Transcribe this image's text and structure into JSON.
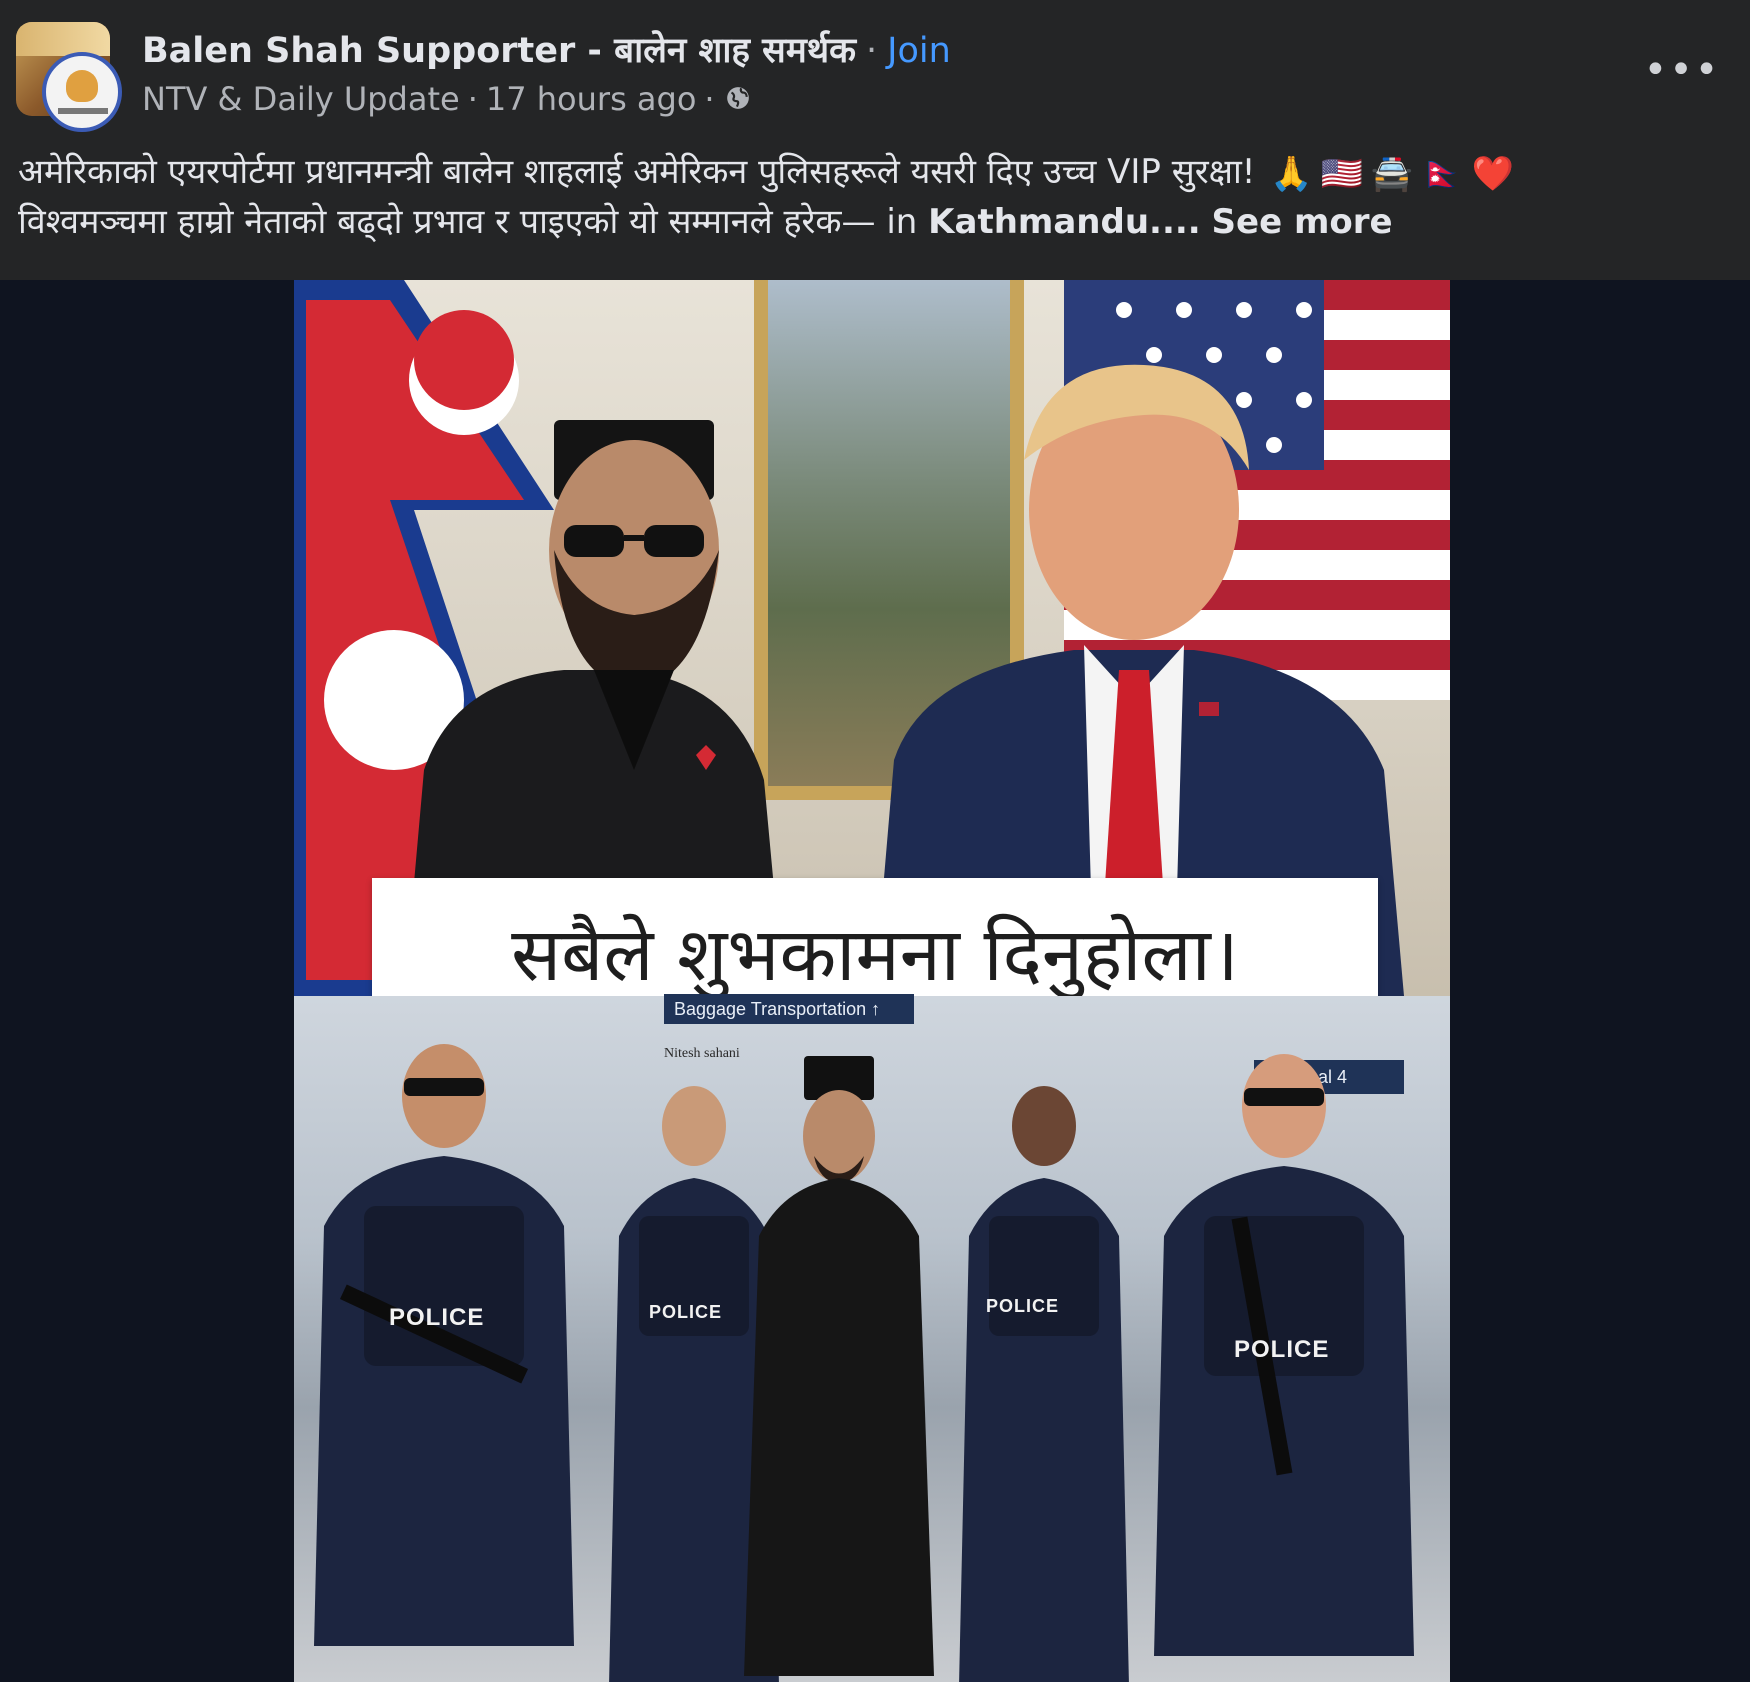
{
  "post": {
    "group_name": "Balen Shah Supporter - बालेन शाह समर्थक",
    "separator": "·",
    "join_label": "Join",
    "author": "NTV & Daily Update",
    "time": "17 hours ago",
    "audience_icon": "globe-icon",
    "more_label": "•••",
    "caption_line1": "अमेरिकाको एयरपोर्टमा प्रधानमन्त्री बालेन शाहलाई अमेरिकन पुलिसहरूले यसरी दिए उच्च VIP सुरक्षा!",
    "caption_emojis": [
      "🙏",
      "🇺🇸",
      "🚔",
      "🇳🇵",
      "❤️"
    ],
    "caption_line2": "विश्वमञ्चमा हाम्रो नेताको बढ्दो प्रभाव र पाइएको यो सम्मानले हरेक— in",
    "location": "Kathmandu",
    "ellipsis": "....",
    "see_more": "See more"
  },
  "image": {
    "banner_text": "सबैले शुभकामना दिनुहोला।",
    "watermark": "Nitesh sahani",
    "sign_baggage": "Baggage Transportation ↑",
    "sign_terminal": "Terminal 4",
    "police_label": "POLICE"
  },
  "colors": {
    "header_bg": "#242526",
    "page_bg": "#0f1420",
    "join": "#4599ff",
    "secondary_text": "#b0b3b8"
  }
}
